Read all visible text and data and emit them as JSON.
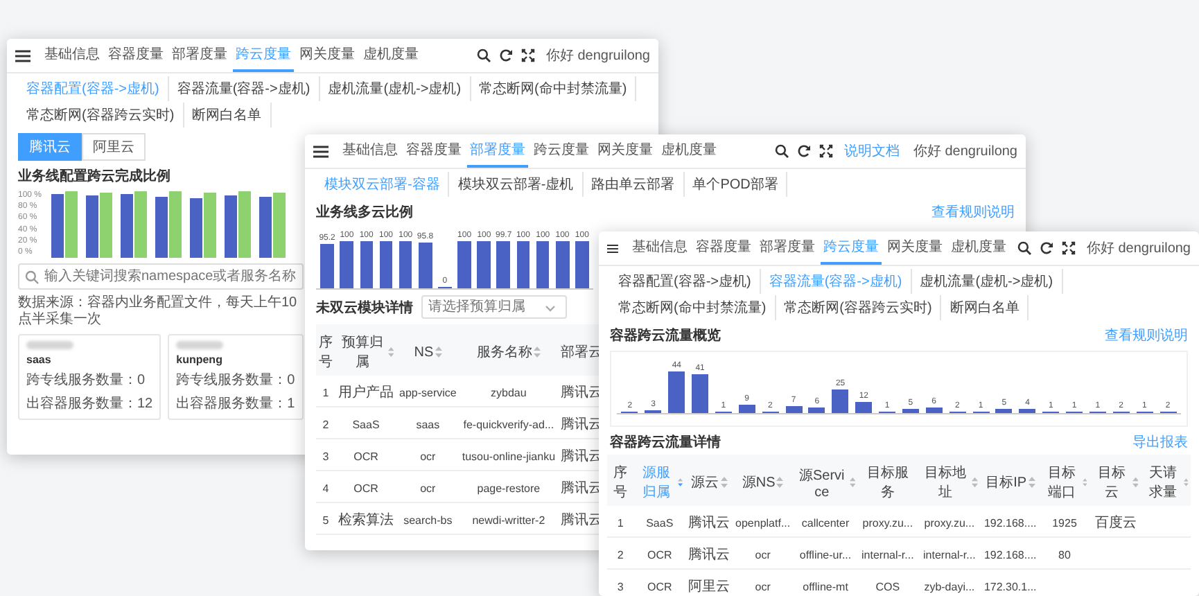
{
  "back_window": {
    "nav": {
      "items": [
        {
          "label": "基础信息",
          "selected": false
        },
        {
          "label": "容器度量",
          "selected": false
        },
        {
          "label": "部署度量",
          "selected": false
        },
        {
          "label": "跨云度量",
          "selected": true
        },
        {
          "label": "网关度量",
          "selected": false
        },
        {
          "label": "虚机度量",
          "selected": false
        }
      ],
      "user": "你好 dengruilong"
    },
    "subtabs": [
      {
        "label": "容器配置(容器->虚机)",
        "selected": true
      },
      {
        "label": "容器流量(容器->虚机)",
        "selected": false
      },
      {
        "label": "虚机流量(虚机->虚机)",
        "selected": false
      },
      {
        "label": "常态断网(命中封禁流量)",
        "selected": false
      },
      {
        "label": "常态断网(容器跨云实时)",
        "selected": false
      },
      {
        "label": "断网白名单",
        "selected": false
      }
    ],
    "cloud_toggle": [
      {
        "label": "腾讯云",
        "selected": true
      },
      {
        "label": "阿里云",
        "selected": false
      }
    ],
    "chart_title": "业务线配置跨云完成比例",
    "y_ticks": [
      "100 %",
      "80 %",
      "60 %",
      "40 %",
      "20 %",
      "0 %"
    ],
    "search": {
      "placeholder": "输入关键词搜索namespace或者服务名称"
    },
    "note": "数据来源：容器内业务配置文件，每天上午10点半采集一次",
    "cards": [
      {
        "name": "saas",
        "lines": [
          "跨专线服务数量：0",
          "出容器服务数量：12"
        ]
      },
      {
        "name": "kunpeng",
        "lines": [
          "跨专线服务数量：0",
          "出容器服务数量：1"
        ]
      }
    ]
  },
  "middle_window": {
    "nav": {
      "items": [
        {
          "label": "基础信息",
          "selected": false
        },
        {
          "label": "容器度量",
          "selected": false
        },
        {
          "label": "部署度量",
          "selected": true
        },
        {
          "label": "跨云度量",
          "selected": false
        },
        {
          "label": "网关度量",
          "selected": false
        },
        {
          "label": "虚机度量",
          "selected": false
        }
      ],
      "doc_link": "说明文档",
      "user": "你好 dengruilong"
    },
    "subtabs": [
      {
        "label": "模块双云部署-容器",
        "selected": true
      },
      {
        "label": "模块双云部署-虚机",
        "selected": false
      },
      {
        "label": "路由单云部署",
        "selected": false
      },
      {
        "label": "单个POD部署",
        "selected": false
      }
    ],
    "chart_title": "业务线多云比例",
    "chart_link": "查看规则说明",
    "bars": [
      {
        "value": "95.2"
      },
      {
        "value": "100"
      },
      {
        "value": "100"
      },
      {
        "value": "100"
      },
      {
        "value": "100"
      },
      {
        "value": "95.8"
      },
      {
        "value": "0"
      },
      {
        "value": "100"
      },
      {
        "value": "100"
      },
      {
        "value": "99.7"
      },
      {
        "value": "100"
      },
      {
        "value": "100"
      },
      {
        "value": "100"
      },
      {
        "value": "100"
      }
    ],
    "detail_title": "未双云模块详情",
    "filter": {
      "placeholder": "请选择预算归属"
    },
    "table": {
      "columns": [
        {
          "label": "序号",
          "sortable": false
        },
        {
          "label": "预算归属",
          "sortable": true
        },
        {
          "label": "NS",
          "sortable": true
        },
        {
          "label": "服务名称",
          "sortable": true
        },
        {
          "label": "部署云",
          "sortable": false
        }
      ],
      "rows": [
        [
          "1",
          "用户产品",
          "app-service",
          "zybdau",
          "腾讯云"
        ],
        [
          "2",
          "SaaS",
          "saas",
          "fe-quickverify-ad...",
          "腾讯云"
        ],
        [
          "3",
          "OCR",
          "ocr",
          "tusou-online-jianku",
          "腾讯云"
        ],
        [
          "4",
          "OCR",
          "ocr",
          "page-restore",
          "腾讯云"
        ],
        [
          "5",
          "检索算法",
          "search-bs",
          "newdi-writter-2",
          "腾讯云"
        ]
      ]
    }
  },
  "front_window": {
    "nav": {
      "items": [
        {
          "label": "基础信息",
          "selected": false
        },
        {
          "label": "容器度量",
          "selected": false
        },
        {
          "label": "部署度量",
          "selected": false
        },
        {
          "label": "跨云度量",
          "selected": true
        },
        {
          "label": "网关度量",
          "selected": false
        },
        {
          "label": "虚机度量",
          "selected": false
        }
      ],
      "user": "你好 dengruilong"
    },
    "subtabs": [
      {
        "label": "容器配置(容器->虚机)",
        "selected": false
      },
      {
        "label": "容器流量(容器->虚机)",
        "selected": true
      },
      {
        "label": "虚机流量(虚机->虚机)",
        "selected": false
      },
      {
        "label": "常态断网(命中封禁流量)",
        "selected": false
      },
      {
        "label": "常态断网(容器跨云实时)",
        "selected": false
      },
      {
        "label": "断网白名单",
        "selected": false
      }
    ],
    "chart_title": "容器跨云流量概览",
    "chart_link": "查看规则说明",
    "bars": [
      {
        "value": "2"
      },
      {
        "value": "3"
      },
      {
        "value": "44"
      },
      {
        "value": "41"
      },
      {
        "value": "1"
      },
      {
        "value": "9"
      },
      {
        "value": "2"
      },
      {
        "value": "7"
      },
      {
        "value": "6"
      },
      {
        "value": "25"
      },
      {
        "value": "12"
      },
      {
        "value": "1"
      },
      {
        "value": "5"
      },
      {
        "value": "6"
      },
      {
        "value": "2"
      },
      {
        "value": "1"
      },
      {
        "value": "5"
      },
      {
        "value": "4"
      },
      {
        "value": "1"
      },
      {
        "value": "1"
      },
      {
        "value": "1"
      },
      {
        "value": "2"
      },
      {
        "value": "1"
      },
      {
        "value": "2"
      }
    ],
    "detail_title": "容器跨云流量详情",
    "detail_link": "导出报表",
    "table": {
      "columns": [
        {
          "label": "序号",
          "sortable": false
        },
        {
          "label": "源服归属",
          "sortable": true
        },
        {
          "label": "源云",
          "sortable": true
        },
        {
          "label": "源NS",
          "sortable": true
        },
        {
          "label": "源Service",
          "sortable": true
        },
        {
          "label": "目标服务",
          "sortable": false
        },
        {
          "label": "目标地址",
          "sortable": true
        },
        {
          "label": "目标IP",
          "sortable": true
        },
        {
          "label": "目标端口",
          "sortable": true
        },
        {
          "label": "目标云",
          "sortable": true
        },
        {
          "label": "天请求量",
          "sortable": true
        }
      ],
      "rows": [
        [
          "1",
          "SaaS",
          "腾讯云",
          "openplatf...",
          "callcenter",
          "proxy.zu...",
          "proxy.zu...",
          "192.168....",
          "1925",
          "百度云"
        ],
        [
          "2",
          "OCR",
          "腾讯云",
          "ocr",
          "offline-ur...",
          "internal-r...",
          "internal-r...",
          "192.168....",
          "80"
        ],
        [
          "3",
          "OCR",
          "阿里云",
          "ocr",
          "offline-mt",
          "COS",
          "zyb-dayi...",
          "172.30.1..."
        ]
      ]
    }
  }
}
